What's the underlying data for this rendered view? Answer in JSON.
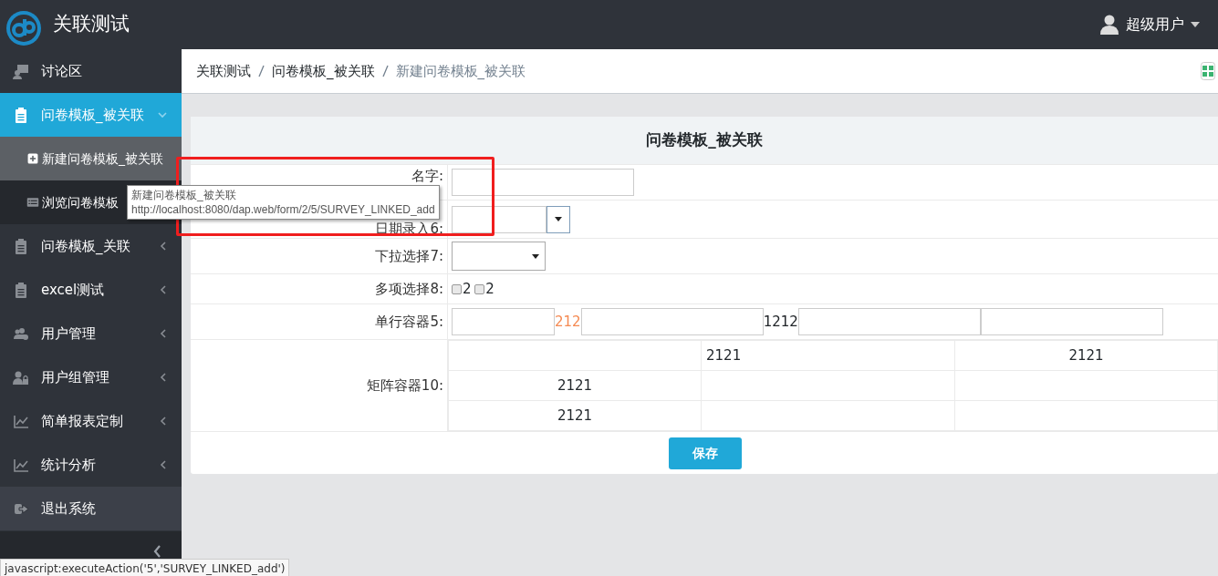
{
  "header": {
    "app_title": "关联测试",
    "user": "超级用户"
  },
  "sidebar": {
    "items": [
      {
        "label": "讨论区",
        "selected": false
      },
      {
        "label": "问卷模板_被关联",
        "selected": true,
        "expanded": true,
        "children": [
          {
            "label": "新建问卷模板_被关联",
            "selected": true
          },
          {
            "label": "浏览问卷模板",
            "selected": false
          }
        ]
      },
      {
        "label": "问卷模板_关联",
        "selected": false,
        "expanded": false
      },
      {
        "label": "excel测试",
        "selected": false,
        "expanded": false
      },
      {
        "label": "用户管理",
        "selected": false,
        "expanded": false
      },
      {
        "label": "用户组管理",
        "selected": false,
        "expanded": false
      },
      {
        "label": "简单报表定制",
        "selected": false,
        "expanded": false
      },
      {
        "label": "统计分析",
        "selected": false,
        "expanded": false
      },
      {
        "label": "退出系统",
        "selected": false
      }
    ]
  },
  "breadcrumb": [
    "关联测试",
    "问卷模板_被关联",
    "新建问卷模板_被关联"
  ],
  "form": {
    "title": "问卷模板_被关联",
    "rows": [
      {
        "label": "名字:",
        "kind": "text"
      },
      {
        "label": "日期录入6:",
        "kind": "date"
      },
      {
        "label": "下拉选择7:",
        "kind": "select"
      },
      {
        "label": "多项选择8:",
        "kind": "checkboxes",
        "options": [
          {
            "label": "2",
            "checked": false
          },
          {
            "label": "2",
            "checked": false
          }
        ]
      },
      {
        "label": "单行容器5:",
        "kind": "inline",
        "items": [
          {
            "kind": "input"
          },
          {
            "kind": "note",
            "text": "212"
          },
          {
            "kind": "input"
          },
          {
            "kind": "text",
            "text": "1212"
          },
          {
            "kind": "input"
          },
          {
            "kind": "input"
          }
        ]
      },
      {
        "label": "矩阵容器10:",
        "kind": "matrix",
        "cells": [
          [
            "",
            "2121",
            "2121"
          ],
          [
            "2121",
            "",
            ""
          ],
          [
            "2121",
            "",
            ""
          ]
        ]
      }
    ],
    "save_button": "保存"
  },
  "tooltip": {
    "title": "新建问卷模板_被关联",
    "url": "http://localhost:8080/dap.web/form/2/5/SURVEY_LINKED_add"
  },
  "status_bar": "javascript:executeAction('5','SURVEY_LINKED_add')"
}
